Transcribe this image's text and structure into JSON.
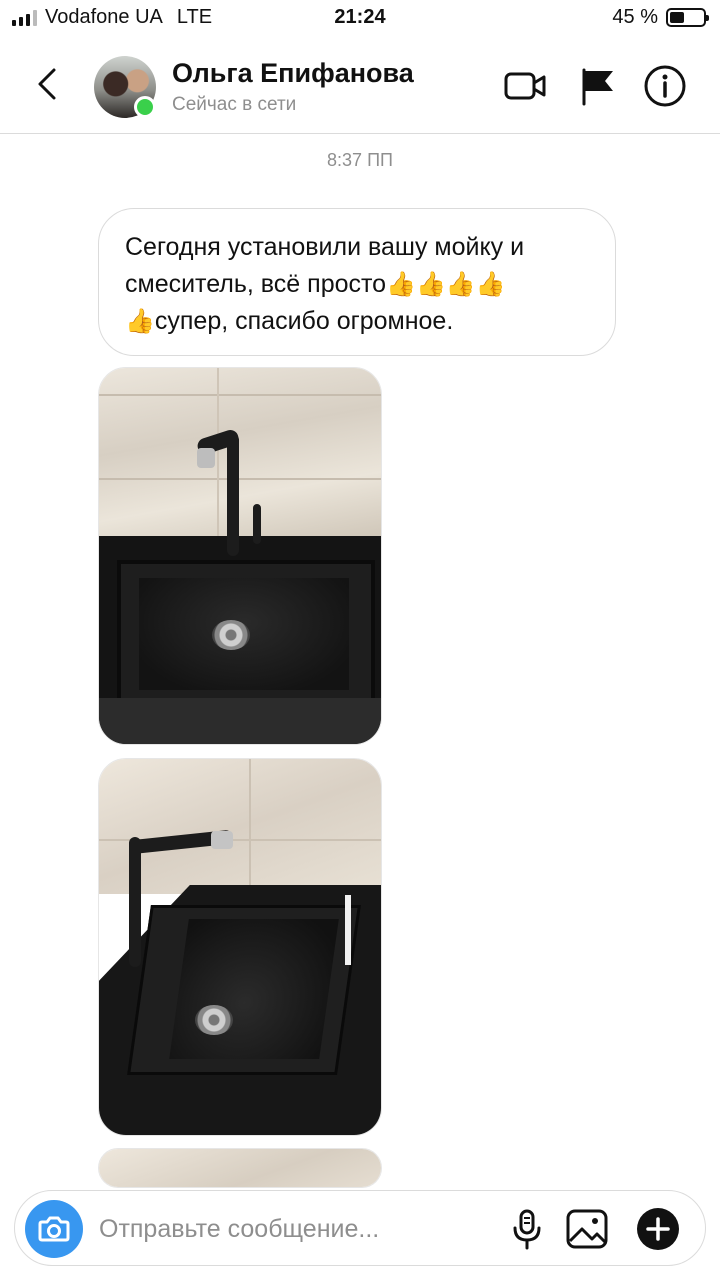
{
  "status_bar": {
    "carrier": "Vodafone UA",
    "network": "LTE",
    "time": "21:24",
    "battery_text": "45 %",
    "battery_level": 0.45
  },
  "header": {
    "contact_name": "Ольга Епифанова",
    "contact_status": "Сейчас в сети",
    "icons": [
      "chevron-left-icon",
      "video-camera-icon",
      "flag-icon",
      "info-icon"
    ],
    "online_color": "#3ad04b"
  },
  "conversation": {
    "timestamp": "8:37 ПП",
    "message": {
      "line1": "Сегодня установили вашу мойку и",
      "line2_text": "смеситель, всё просто",
      "line2_emoji": "👍👍👍👍",
      "line3_emoji": "👍",
      "line3_text": "супер, спасибо огромное."
    },
    "photos": [
      "kitchen-sink-photo-1",
      "kitchen-sink-photo-2",
      "kitchen-sink-photo-3"
    ]
  },
  "composer": {
    "placeholder": "Отправьте сообщение...",
    "value": "",
    "accent_color": "#3897f0"
  }
}
